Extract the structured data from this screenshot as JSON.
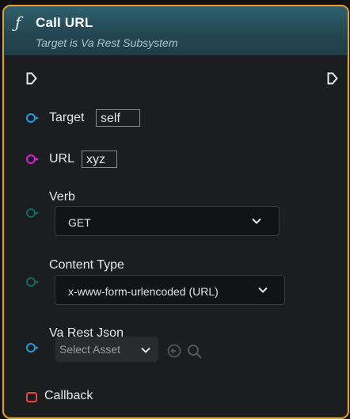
{
  "node": {
    "title": "Call URL",
    "subtitle": "Target is Va Rest Subsystem",
    "function_icon": "ƒ"
  },
  "pins": {
    "target": {
      "label": "Target",
      "value": "self",
      "color": "#1f9bdc"
    },
    "url": {
      "label": "URL",
      "value": "xyz",
      "color": "#d81fd0"
    },
    "verb": {
      "label": "Verb",
      "selected": "GET",
      "color": "#0e6b5f"
    },
    "content_type": {
      "label": "Content Type",
      "selected": "x-www-form-urlencoded (URL)",
      "color": "#0e6b5f"
    },
    "va_rest_json": {
      "label": "Va Rest Json",
      "placeholder": "Select Asset",
      "color": "#1f9bdc"
    },
    "callback": {
      "label": "Callback",
      "color": "#e2453c"
    }
  },
  "colors": {
    "border": "#e6a12a",
    "header": "#2f5f6c",
    "body": "#1c1d1f"
  }
}
